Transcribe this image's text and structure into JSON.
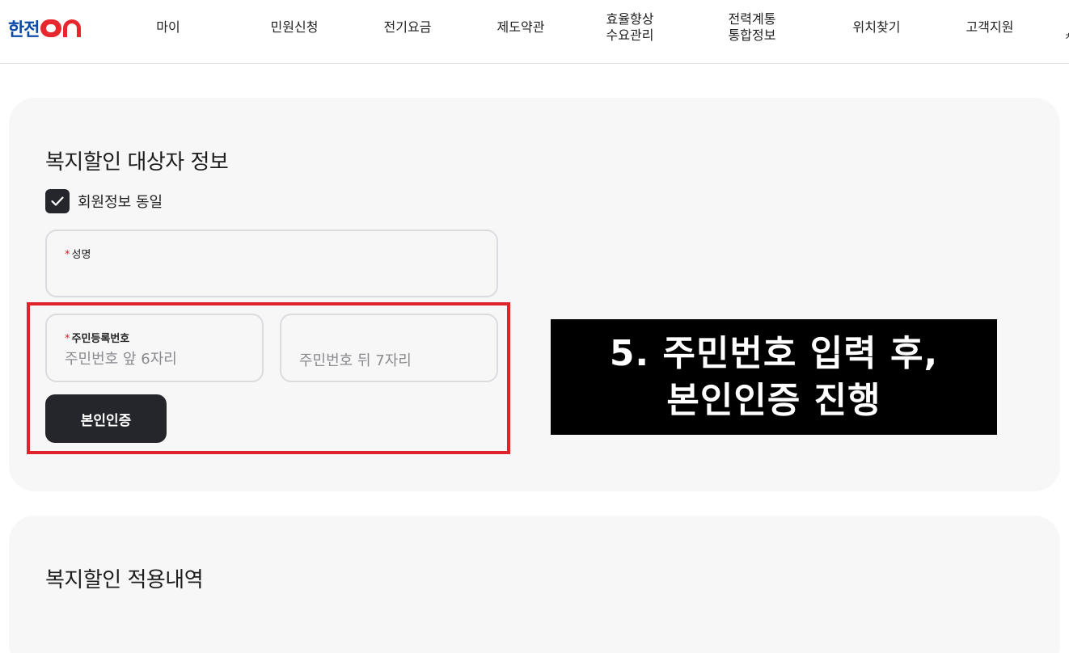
{
  "header": {
    "logo_text": "한전",
    "nav": [
      {
        "label": "마이"
      },
      {
        "label": "민원신청"
      },
      {
        "label": "전기요금"
      },
      {
        "label": "제도약관"
      },
      {
        "line1": "효율향상",
        "line2": "수요관리"
      },
      {
        "line1": "전력계통",
        "line2": "통합정보"
      },
      {
        "label": "위치찾기"
      },
      {
        "label": "고객지원"
      }
    ],
    "edge_glyph": "ㅊ"
  },
  "welfare_info": {
    "title": "복지할인 대상자 정보",
    "same_as_member": {
      "label": "회원정보 동일",
      "checked": true
    },
    "name_field": {
      "required_mark": "*",
      "label": "성명",
      "value": ""
    },
    "rrn_front": {
      "required_mark": "*",
      "label": "주민등록번호",
      "placeholder": "주민번호 앞 6자리"
    },
    "rrn_back": {
      "placeholder": "주민번호 뒤 7자리"
    },
    "verify_button": "본인인증"
  },
  "caption": {
    "line1": "5. 주민번호 입력 후,",
    "line2": "본인인증 진행"
  },
  "discount_history": {
    "title": "복지할인 적용내역"
  },
  "colors": {
    "brand_blue": "#0a4aa8",
    "brand_red": "#e8262d",
    "highlight_red": "#e0222b",
    "dark_button": "#25262b",
    "card_bg": "#f7f7f8"
  }
}
